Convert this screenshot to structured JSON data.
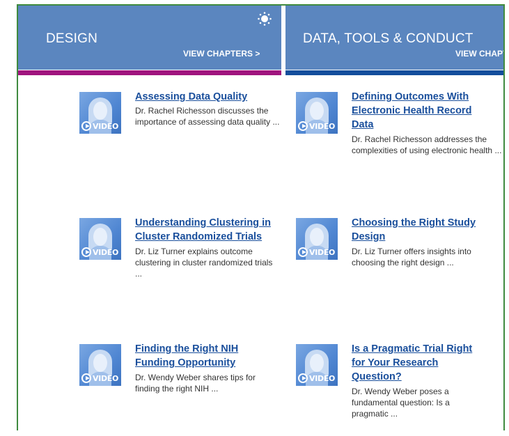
{
  "panels": [
    {
      "title": "DESIGN",
      "link": "VIEW CHAPTERS >"
    },
    {
      "title": "DATA, TOOLS & CONDUCT",
      "link": "VIEW CHAPT"
    }
  ],
  "colors": {
    "header": "#5b86bf",
    "design_bar": "#a0147e",
    "data_bar": "#134e9c",
    "link": "#1a4f9c",
    "frame": "#3f8a3f"
  },
  "icons": {
    "brightness": "sun-icon",
    "play": "play-circle-icon"
  },
  "video_label": "VIDEO",
  "cards": [
    {
      "title": "Assessing Data Quality",
      "desc": " Dr. Rachel Richesson discusses the importance of assessing data quality ..."
    },
    {
      "title": "Defining Outcomes With Electronic Health Record Data",
      "desc": " Dr. Rachel Richesson addresses the complexities of using electronic health ..."
    },
    {
      "title": "Understanding Clustering in Cluster Randomized Trials",
      "desc": " Dr. Liz Turner explains outcome clustering in cluster randomized trials ..."
    },
    {
      "title": "Choosing the Right Study Design",
      "desc": " Dr. Liz Turner offers insights into choosing the right design ..."
    },
    {
      "title": "Finding the Right NIH Funding Opportunity",
      "desc": " Dr. Wendy Weber shares tips for finding the right NIH ..."
    },
    {
      "title": "Is a Pragmatic Trial Right for Your Research Question?",
      "desc": " Dr. Wendy Weber poses a fundamental question: Is a pragmatic ..."
    }
  ]
}
